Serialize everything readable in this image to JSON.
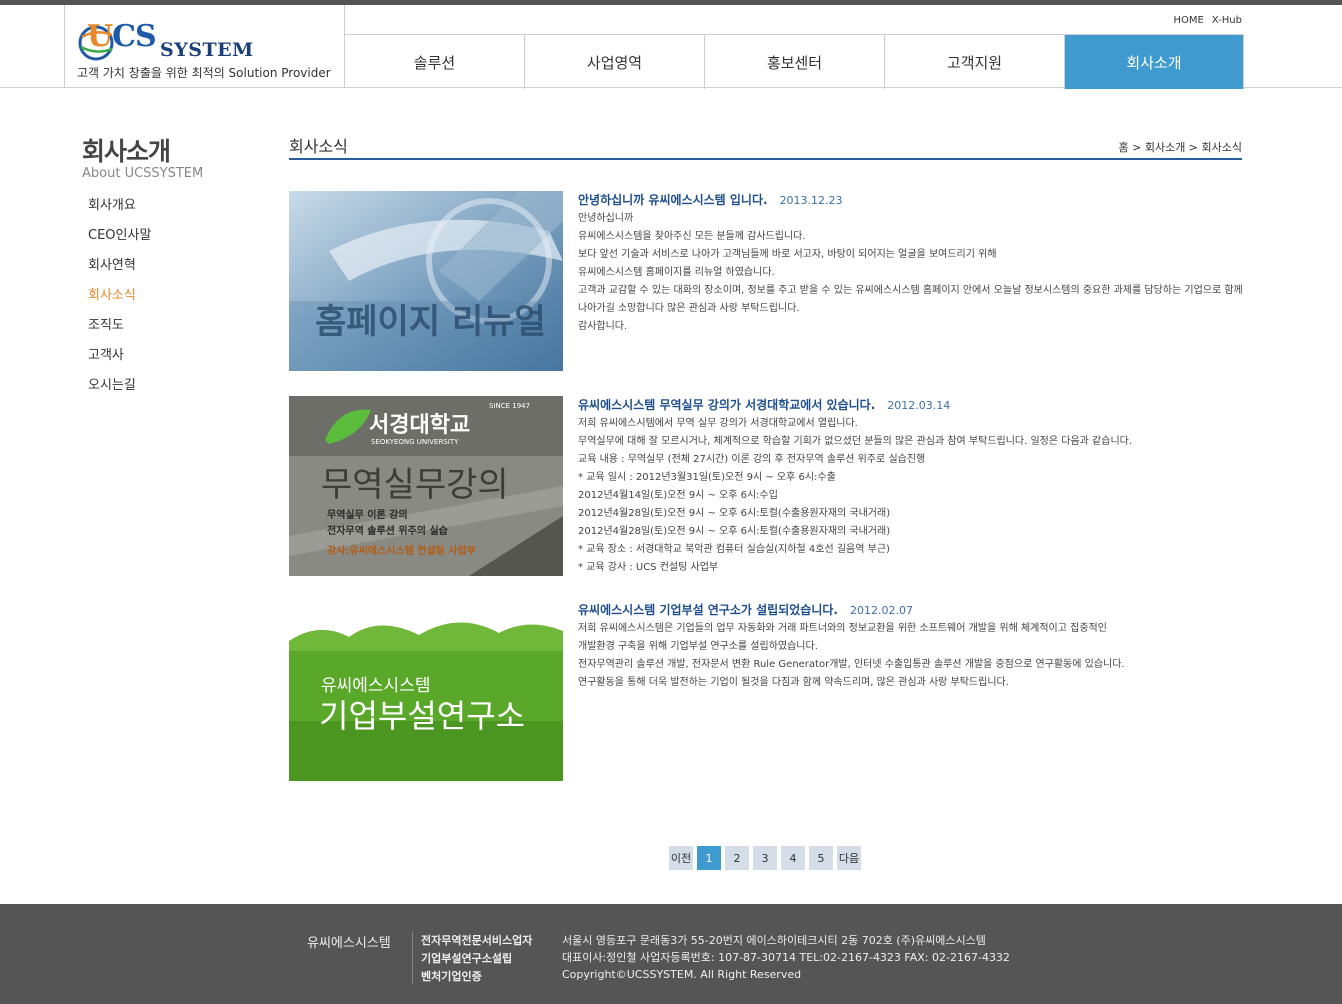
{
  "header": {
    "logo_u": "U",
    "logo_cs": "CS",
    "logo_system": "SYSTEM",
    "slogan": "고객 가치 창출을 위한 최적의 Solution Provider",
    "util": [
      "HOME",
      "X-Hub"
    ],
    "nav": [
      "솔루션",
      "사업영역",
      "홍보센터",
      "고객지원",
      "회사소개"
    ],
    "nav_active": "회사소개"
  },
  "sidebar": {
    "title": "회사소개",
    "subtitle": "About UCSSYSTEM",
    "items": [
      "회사개요",
      "CEO인사말",
      "회사연혁",
      "회사소식",
      "조직도",
      "고객사",
      "오시는길"
    ],
    "active": "회사소식"
  },
  "content": {
    "title": "회사소식",
    "breadcrumb": "홈 > 회사소개 > 회사소식"
  },
  "news": [
    {
      "thumb_text": "홈페이지 리뉴얼",
      "title": "안녕하십니까 유씨에스시스템 입니다.",
      "date": "2013.12.23",
      "lines": [
        "안녕하십니까",
        "유씨에스시스템을 찾아주신 모든 분들께 감사드립니다.",
        "보다 앞선 기술과 서비스로 나아가 고객님들께 바로 서고자, 바탕이 되어지는 얼굴을 보여드리기 위해",
        "유씨에스시스템 홈페이지를 리뉴얼 하였습니다.",
        "고객과 교감할 수 있는 대화의 장소이며, 정보를 주고 받을 수 있는 유씨에스시스템 홈페이지 안에서 오늘날 정보시스템의 중요한 과제를 담당하는 기업으로 함께 나아가길 소망합니다 많은 관심과 사랑 부탁드립니다.",
        "감사합니다."
      ]
    },
    {
      "thumb_since": "SINCE 1947",
      "thumb_univ": "서경대학교",
      "thumb_univ_en": "SEOKYEONG UNIVERSITY",
      "thumb_main": "무역실무강의",
      "thumb_sub1": "무역실무 이론 강의",
      "thumb_sub2": "전자무역 솔루션 위주의 실습",
      "thumb_sub3": "강사:유씨에스시스템 컨설팅 사업부",
      "title": "유씨에스시스템 무역실무 강의가 서경대학교에서 있습니다.",
      "date": "2012.03.14",
      "lines": [
        "저희 유씨에스시템에서 무역 실무 강의가 서경대학교에서 열립니다.",
        "무역실무에 대해 잘 모르시거나, 체계적으로 학습할 기회가 없으셨던 분들의 많은 관심과 참여 부탁드립니다. 일정은 다음과 같습니다.",
        "교육 내용 : 무역실무 (전체 27시간) 이론 강의 후 전자무역 솔루션 위주로 실습진행",
        "* 교육 일시 : 2012년3월31일(토)오전 9시 ~ 오후 6시:수출",
        "2012년4월14일(토)오전 9시 ~ 오후 6시:수입",
        "2012년4월28일(토)오전 9시 ~ 오후 6시:토컬(수출용원자재의 국내거래)",
        "2012년4월28일(토)오전 9시 ~ 오후 6시:토컬(수출용원자재의 국내거래)",
        "* 교육 장소 : 서경대학교 북악관 컴퓨터 실습실(지하철 4호선 길음역 부근)",
        "* 교육 강사 : UCS 컨설팅 사업부"
      ]
    },
    {
      "thumb_small": "유씨에스시스템",
      "thumb_big": "기업부설연구소",
      "title": "유씨에스시스템 기업부설 연구소가 설립되었습니다.",
      "date": "2012.02.07",
      "lines": [
        "저희 유씨에스시스템은 기업들의 업무 자동화와 거래 파트너와의 정보교환을 위한 소프트웨어 개발을 위해 체계적이고 집중적인",
        "개발환경 구축을 위해 기업부설 연구소를 설립하였습니다.",
        "전자무역관리 솔루션 개발, 전자문서 변환 Rule Generator개발, 인터넷 수출입통관 솔루션 개발을 중점으로 연구활동에 있습니다.",
        "연구활동을 통해 더욱 발전하는 기업이 될것을 다짐과 함께 약속드리며, 많은 관심과 사랑 부탁드립니다."
      ]
    }
  ],
  "pager": {
    "prev": "이전",
    "pages": [
      "1",
      "2",
      "3",
      "4",
      "5"
    ],
    "current": "1",
    "next": "다음"
  },
  "footer": {
    "company": "유씨에스시스템",
    "certs": [
      "전자무역전문서비스업자",
      "기업부설연구소설립",
      "벤처기업인증"
    ],
    "address": "서울시 영등포구 문래동3가 55-20번지 에이스하이테크시티 2동 702호 (주)유씨에스시스템",
    "ceo": "대표이사:정인철 사업자등록번호: 107-87-30714 TEL:02-2167-4323 FAX: 02-2167-4332",
    "copyright": "Copyright©UCSSYSTEM. All Right Reserved"
  }
}
